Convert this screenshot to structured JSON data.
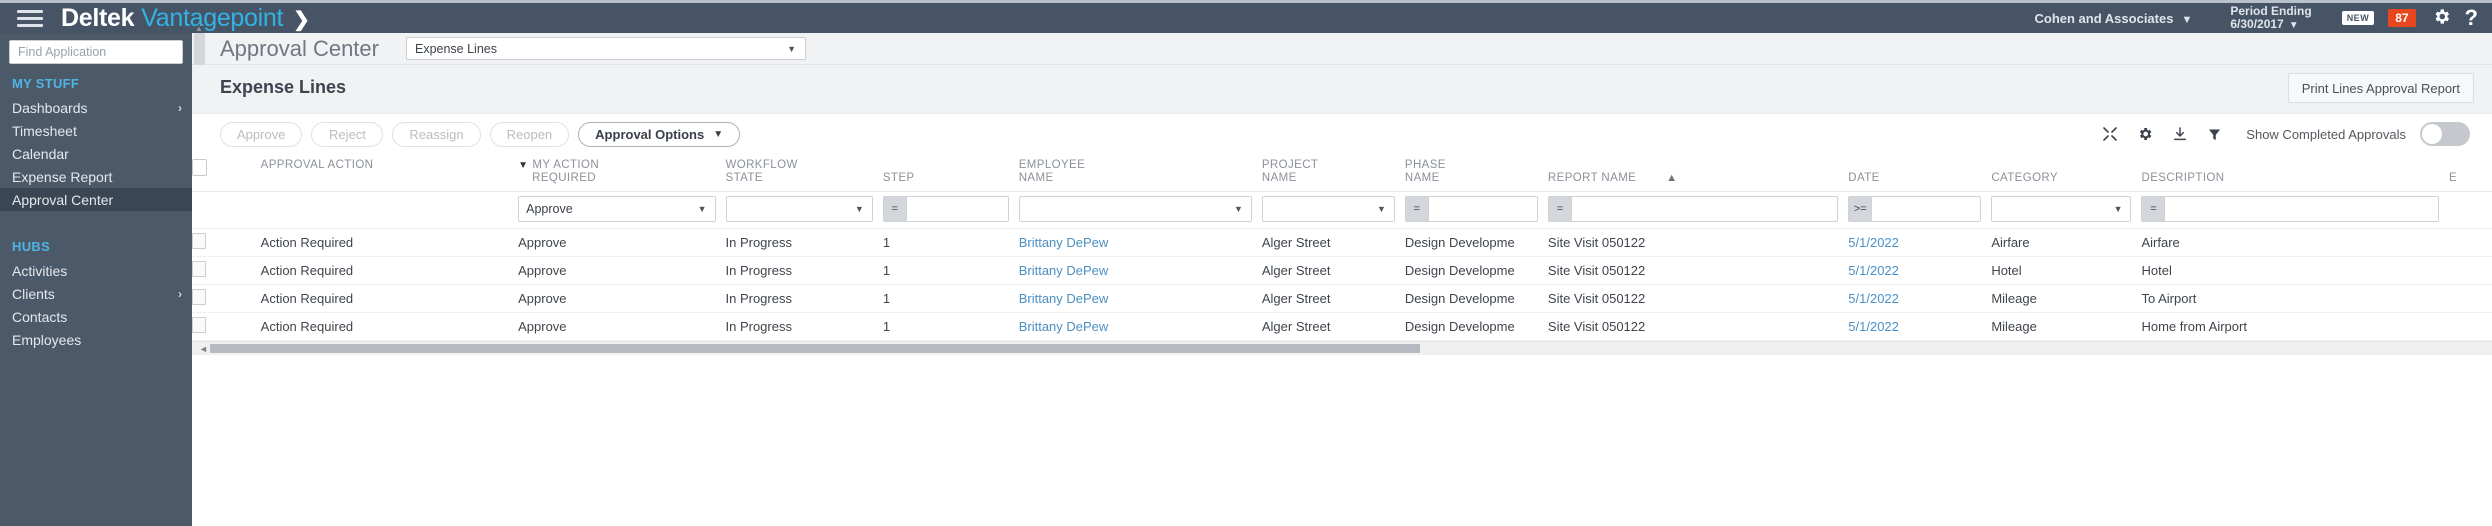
{
  "topbar": {
    "menu_icon": "hamburger-icon",
    "brand_primary": "Deltek",
    "brand_secondary": "Vantagepoint",
    "brand_chevron": "❯",
    "company": "Cohen and Associates",
    "company_caret": "▼",
    "period_label": "Period Ending",
    "period_value": "6/30/2017",
    "period_caret": "▼",
    "new_badge": "NEW",
    "count_badge": "87",
    "gear_icon": "gear-icon",
    "help_icon": "?"
  },
  "sidebar": {
    "search_placeholder": "Find Application",
    "sections": [
      {
        "title": "MY STUFF",
        "items": [
          {
            "label": "Dashboards",
            "arrow": "›",
            "active": false
          },
          {
            "label": "Timesheet",
            "arrow": "",
            "active": false
          },
          {
            "label": "Calendar",
            "arrow": "",
            "active": false
          },
          {
            "label": "Expense Report",
            "arrow": "",
            "active": false
          },
          {
            "label": "Approval Center",
            "arrow": "",
            "active": true
          }
        ]
      },
      {
        "title": "HUBS",
        "items": [
          {
            "label": "Activities",
            "arrow": "",
            "active": false
          },
          {
            "label": "Clients",
            "arrow": "›",
            "active": false
          },
          {
            "label": "Contacts",
            "arrow": "",
            "active": false
          },
          {
            "label": "Employees",
            "arrow": "",
            "active": false
          }
        ]
      }
    ]
  },
  "page": {
    "title": "Approval Center",
    "selector_value": "Expense Lines",
    "selector_caret": "▼",
    "section_title": "Expense Lines",
    "print_button": "Print Lines Approval Report"
  },
  "toolbar": {
    "approve": "Approve",
    "reject": "Reject",
    "reassign": "Reassign",
    "reopen": "Reopen",
    "approval_options": "Approval Options",
    "approval_options_caret": "▼",
    "expand_icon": "expand-collapse-icon",
    "settings_icon": "gear-icon",
    "export_icon": "download-icon",
    "filter_icon": "funnel-icon",
    "show_completed_label": "Show Completed Approvals",
    "toggle_state": "off"
  },
  "table": {
    "columns": [
      {
        "key": "checkbox",
        "label": "",
        "line2": ""
      },
      {
        "key": "approval_action",
        "label": "APPROVAL ACTION",
        "line2": ""
      },
      {
        "key": "my_action_required",
        "label": "MY ACTION",
        "line2": "REQUIRED",
        "filtered": true
      },
      {
        "key": "workflow_state",
        "label": "WORKFLOW",
        "line2": "STATE"
      },
      {
        "key": "step",
        "label": "STEP",
        "line2": ""
      },
      {
        "key": "employee_name",
        "label": "EMPLOYEE",
        "line2": "NAME"
      },
      {
        "key": "project_name",
        "label": "PROJECT",
        "line2": "NAME"
      },
      {
        "key": "phase_name",
        "label": "PHASE",
        "line2": "NAME"
      },
      {
        "key": "report_name",
        "label": "REPORT NAME",
        "line2": "",
        "sort": "asc"
      },
      {
        "key": "date",
        "label": "DATE",
        "line2": ""
      },
      {
        "key": "category",
        "label": "CATEGORY",
        "line2": ""
      },
      {
        "key": "description",
        "label": "DESCRIPTION",
        "line2": ""
      },
      {
        "key": "extra",
        "label": "E",
        "line2": ""
      }
    ],
    "filters": {
      "my_action_required": {
        "value": "Approve",
        "type": "select"
      },
      "workflow_state": {
        "value": "",
        "type": "select"
      },
      "step": {
        "value": "",
        "type": "operator",
        "op": "="
      },
      "employee_name": {
        "value": "",
        "type": "select"
      },
      "project_name": {
        "value": "",
        "type": "select"
      },
      "phase_name": {
        "value": "",
        "type": "operator",
        "op": "="
      },
      "report_name": {
        "value": "",
        "type": "operator",
        "op": "="
      },
      "date": {
        "value": "",
        "type": "operator",
        "op": ">="
      },
      "category": {
        "value": "",
        "type": "select"
      },
      "description": {
        "value": "",
        "type": "operator",
        "op": "="
      }
    },
    "rows": [
      {
        "approval_action": "Action Required",
        "my_action_required": "Approve",
        "workflow_state": "In Progress",
        "step": "1",
        "employee_name": "Brittany DePew",
        "project_name": "Alger Street",
        "phase_name": "Design Developme",
        "report_name": "Site Visit 050122",
        "date": "5/1/2022",
        "category": "Airfare",
        "description": "Airfare"
      },
      {
        "approval_action": "Action Required",
        "my_action_required": "Approve",
        "workflow_state": "In Progress",
        "step": "1",
        "employee_name": "Brittany DePew",
        "project_name": "Alger Street",
        "phase_name": "Design Developme",
        "report_name": "Site Visit 050122",
        "date": "5/1/2022",
        "category": "Hotel",
        "description": "Hotel"
      },
      {
        "approval_action": "Action Required",
        "my_action_required": "Approve",
        "workflow_state": "In Progress",
        "step": "1",
        "employee_name": "Brittany DePew",
        "project_name": "Alger Street",
        "phase_name": "Design Developme",
        "report_name": "Site Visit 050122",
        "date": "5/1/2022",
        "category": "Mileage",
        "description": "To Airport"
      },
      {
        "approval_action": "Action Required",
        "my_action_required": "Approve",
        "workflow_state": "In Progress",
        "step": "1",
        "employee_name": "Brittany DePew",
        "project_name": "Alger Street",
        "phase_name": "Design Developme",
        "report_name": "Site Visit 050122",
        "date": "5/1/2022",
        "category": "Mileage",
        "description": "Home from Airport"
      }
    ]
  },
  "colors": {
    "brand_blue": "#32b3e5",
    "topbar": "#475465",
    "sidebar": "#4c5969",
    "badge_orange": "#e8461f",
    "link_blue": "#4a90c4"
  }
}
